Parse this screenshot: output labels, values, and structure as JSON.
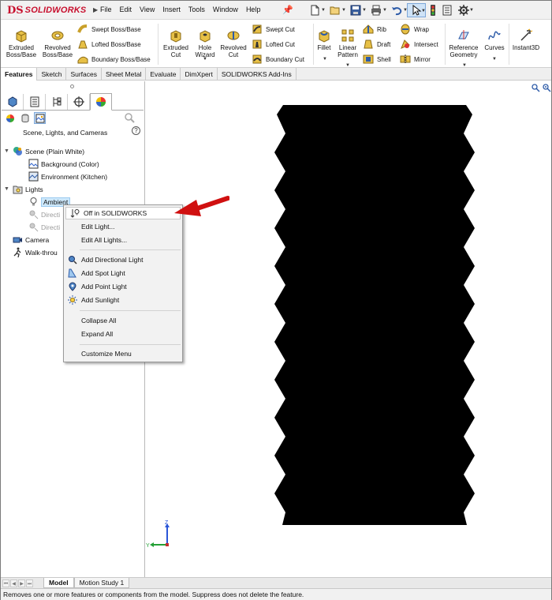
{
  "app": {
    "logo_text": "SOLIDWORKS",
    "logo_prefix": "DS"
  },
  "menu": [
    "File",
    "Edit",
    "View",
    "Insert",
    "Tools",
    "Window",
    "Help"
  ],
  "quick_access": [
    "new-icon",
    "open-icon",
    "save-icon",
    "print-icon",
    "undo-icon",
    "select-icon",
    "traffic-light-icon",
    "file-properties-icon",
    "options-icon"
  ],
  "ribbon": {
    "extruded_boss": "Extruded Boss/Base",
    "revolved_boss": "Revolved Boss/Base",
    "swept_boss": "Swept Boss/Base",
    "lofted_boss": "Lofted Boss/Base",
    "boundary_boss": "Boundary Boss/Base",
    "extruded_cut": "Extruded Cut",
    "hole_wizard": "Hole Wizard",
    "revolved_cut": "Revolved Cut",
    "swept_cut": "Swept Cut",
    "lofted_cut": "Lofted Cut",
    "boundary_cut": "Boundary Cut",
    "fillet": "Fillet",
    "linear_pattern": "Linear Pattern",
    "rib": "Rib",
    "draft": "Draft",
    "shell": "Shell",
    "wrap": "Wrap",
    "intersect": "Intersect",
    "mirror": "Mirror",
    "reference_geometry": "Reference Geometry",
    "curves": "Curves",
    "instant3d": "Instant3D"
  },
  "tabs": [
    "Features",
    "Sketch",
    "Surfaces",
    "Sheet Metal",
    "Evaluate",
    "DimXpert",
    "SOLIDWORKS Add-Ins"
  ],
  "active_tab": "Features",
  "panel": {
    "title": "Scene, Lights, and Cameras",
    "help": "?",
    "tree": {
      "scene": "Scene (Plain White)",
      "background": "Background (Color)",
      "environment": "Environment (Kitchen)",
      "lights": "Lights",
      "ambient": "Ambient",
      "directional1": "Directi",
      "directional2": "Directi",
      "camera": "Camera",
      "walkthrough": "Walk-throu"
    }
  },
  "context_menu": {
    "off_in_solidworks": "Off in SOLIDWORKS",
    "edit_light": "Edit Light...",
    "edit_all_lights": "Edit All Lights...",
    "add_directional": "Add Directional Light",
    "add_spot": "Add Spot Light",
    "add_point": "Add Point Light",
    "add_sunlight": "Add Sunlight",
    "collapse_all": "Collapse All",
    "expand_all": "Expand All",
    "customize_menu": "Customize Menu"
  },
  "triad": {
    "z": "Z",
    "y": "Y"
  },
  "bottom_tabs": [
    "Model",
    "Motion Study 1"
  ],
  "active_bottom_tab": "Model",
  "status": "Removes one or more features or components from the model. Suppress does not delete the feature.",
  "colors": {
    "brand_red": "#c8102e",
    "callout_red": "#d01010",
    "selection_blue": "#cde8fb",
    "part_black": "#000000"
  }
}
